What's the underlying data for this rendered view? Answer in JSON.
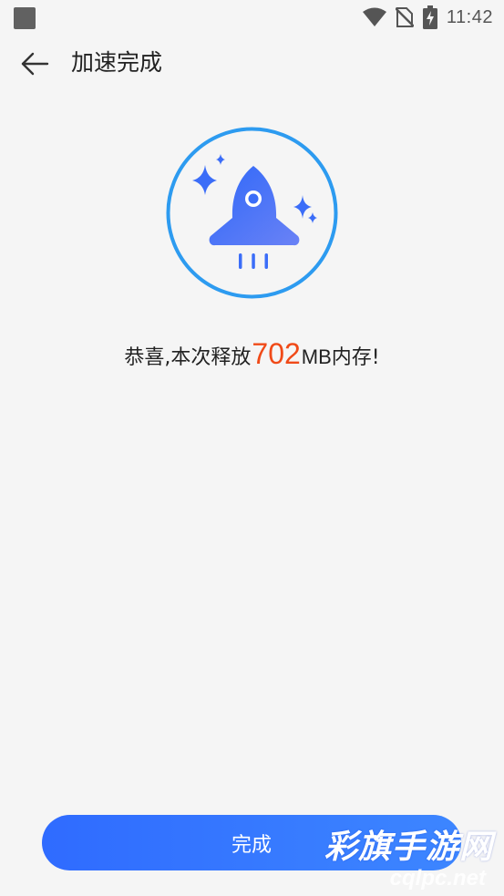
{
  "status_bar": {
    "time": "11:42",
    "icons": [
      "app-notification-icon",
      "wifi-icon",
      "no-sim-icon",
      "battery-charging-icon"
    ]
  },
  "header": {
    "back_icon": "back-arrow-icon",
    "title": "加速完成"
  },
  "illustration": {
    "icon": "rocket-icon",
    "decorations": [
      "sparkle-icon"
    ],
    "ring_color": "#2d9bf0",
    "rocket_gradient": [
      "#2f68f8",
      "#5a7ef7"
    ]
  },
  "result": {
    "prefix": "恭喜,本次释放",
    "amount": "702",
    "unit": "MB",
    "suffix": "内存!",
    "amount_color": "#f04a18"
  },
  "footer": {
    "done_label": "完成",
    "button_color": "#3478ff"
  },
  "watermark": {
    "main": "彩旗手游网",
    "sub": "cqlpc.net"
  }
}
